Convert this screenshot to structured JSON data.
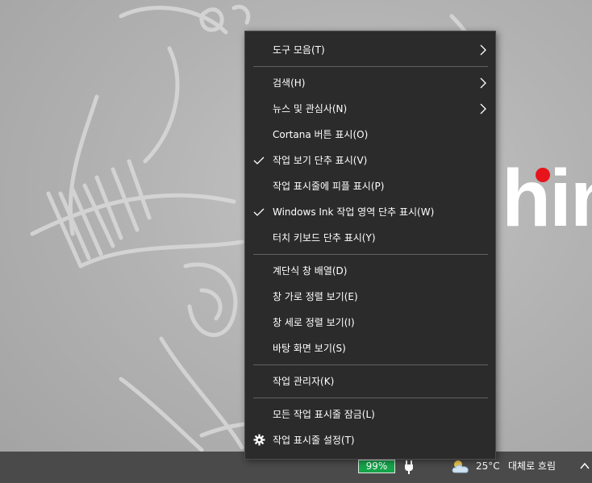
{
  "context_menu": {
    "items": [
      {
        "label": "도구 모음(T)"
      },
      {
        "label": "검색(H)"
      },
      {
        "label": "뉴스 및 관심사(N)"
      },
      {
        "label": "Cortana 버튼 표시(O)"
      },
      {
        "label": "작업 보기 단추 표시(V)",
        "checked": true
      },
      {
        "label": "작업 표시줄에 피플 표시(P)"
      },
      {
        "label": "Windows Ink 작업 영역 단추 표시(W)",
        "checked": true
      },
      {
        "label": "터치 키보드 단추 표시(Y)"
      },
      {
        "label": "계단식 창 배열(D)"
      },
      {
        "label": "창 가로 정렬 보기(E)"
      },
      {
        "label": "창 세로 정렬 보기(I)"
      },
      {
        "label": "바탕 화면 보기(S)"
      },
      {
        "label": "작업 관리자(K)"
      },
      {
        "label": "모든 작업 표시줄 잠금(L)"
      },
      {
        "label": "작업 표시줄 설정(T)",
        "icon": "gear-icon"
      }
    ]
  },
  "desktop": {
    "brand_text": "hink"
  },
  "taskbar": {
    "battery": "99%",
    "weather_temp": "25°C",
    "weather_desc": "대체로 흐림"
  },
  "colors": {
    "menu_bg": "#2b2b2b",
    "taskbar_bg": "#4a4a4a",
    "battery_green": "#16a34a",
    "brand_red": "#e8141c"
  }
}
